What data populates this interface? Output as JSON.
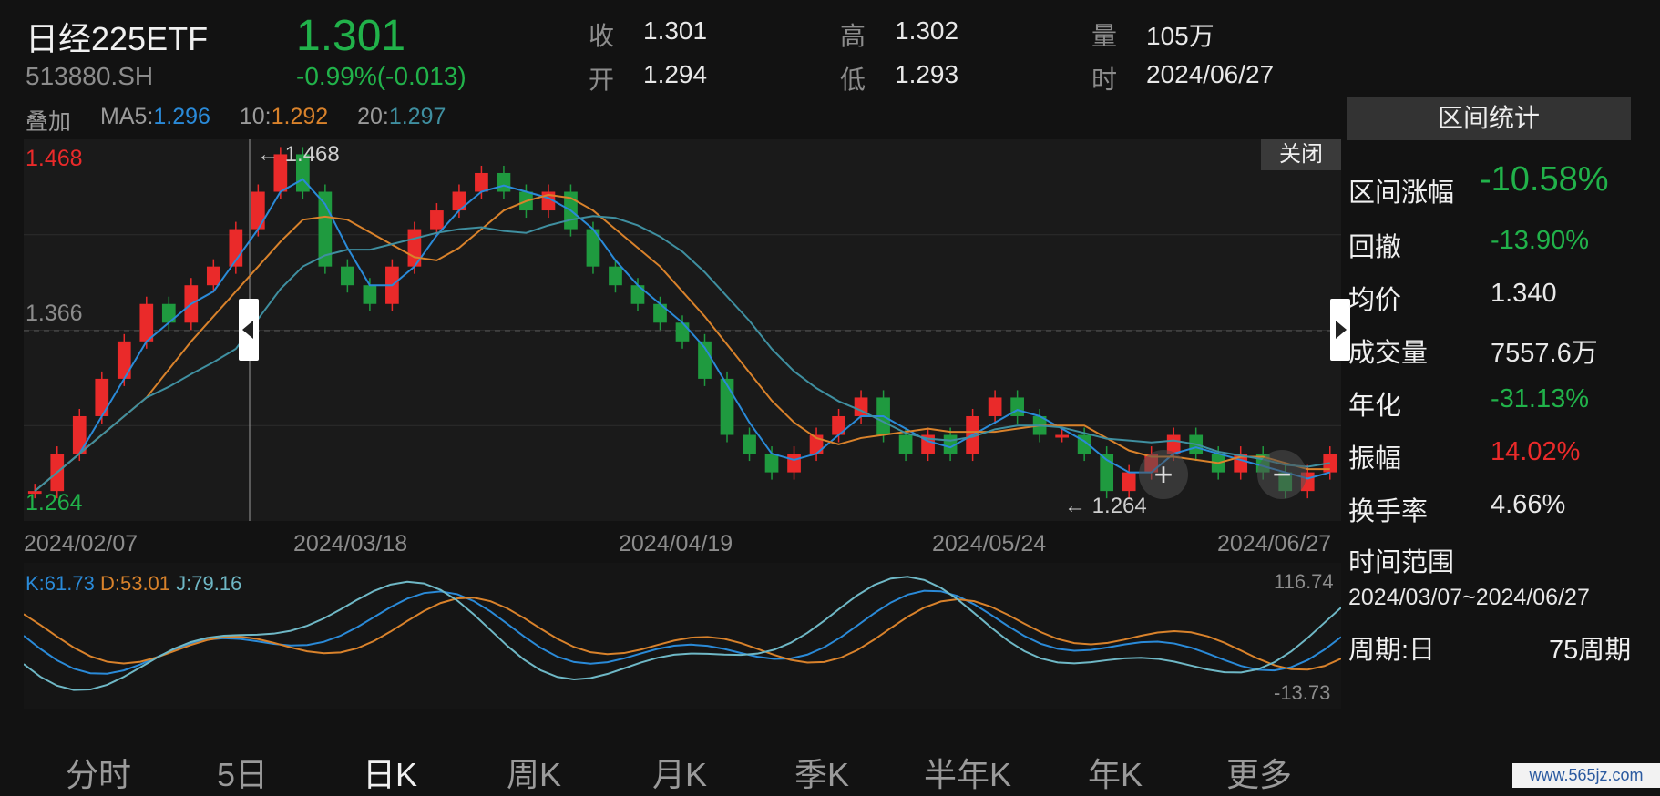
{
  "header": {
    "name": "日经225ETF",
    "code": "513880.SH",
    "last": "1.301",
    "change": "-0.99%(-0.013)",
    "quotes": [
      {
        "label": "收",
        "value": "1.301"
      },
      {
        "label": "开",
        "value": "1.294"
      },
      {
        "label": "高",
        "value": "1.302"
      },
      {
        "label": "低",
        "value": "1.293"
      },
      {
        "label": "量",
        "value": "105万"
      },
      {
        "label": "时",
        "value": "2024/06/27"
      }
    ]
  },
  "ma_bar": {
    "overlay": "叠加",
    "ma5_label": "MA5:",
    "ma5": "1.296",
    "ma10_label": "10:",
    "ma10": "1.292",
    "ma20_label": "20:",
    "ma20": "1.297"
  },
  "chart": {
    "high_label": "1.468",
    "mid_label": "1.366",
    "low_label": "1.264",
    "max_marker": "1.468",
    "min_marker": "1.264",
    "close_button": "关闭",
    "dates": [
      "2024/02/07",
      "2024/03/18",
      "2024/04/19",
      "2024/05/24",
      "2024/06/27"
    ],
    "colors": {
      "up": "#ea2a2a",
      "down": "#1f9a3f",
      "ma5": "#2a8ad8",
      "ma10": "#d9822b",
      "ma20": "#3f8fa0"
    }
  },
  "kdj": {
    "k_label": "K:61.73",
    "d_label": "D:53.01",
    "j_label": "J:79.16",
    "top": "116.74",
    "bottom": "-13.73"
  },
  "stats": {
    "title": "区间统计",
    "rows": [
      {
        "label": "区间涨幅",
        "value": "-10.58%"
      },
      {
        "label": "回撤",
        "value": "-13.90%"
      },
      {
        "label": "均价",
        "value": "1.340"
      },
      {
        "label": "成交量",
        "value": "7557.6万"
      },
      {
        "label": "年化",
        "value": "-31.13%"
      },
      {
        "label": "振幅",
        "value": "14.02%"
      },
      {
        "label": "换手率",
        "value": "4.66%"
      }
    ],
    "range_label": "时间范围",
    "range_value": "2024/03/07~2024/06/27",
    "period_label": "周期:日",
    "period_value": "75周期"
  },
  "tabs": [
    "分时",
    "5日",
    "日K",
    "周K",
    "月K",
    "季K",
    "半年K",
    "年K",
    "更多"
  ],
  "watermark": "www.565jz.com"
}
